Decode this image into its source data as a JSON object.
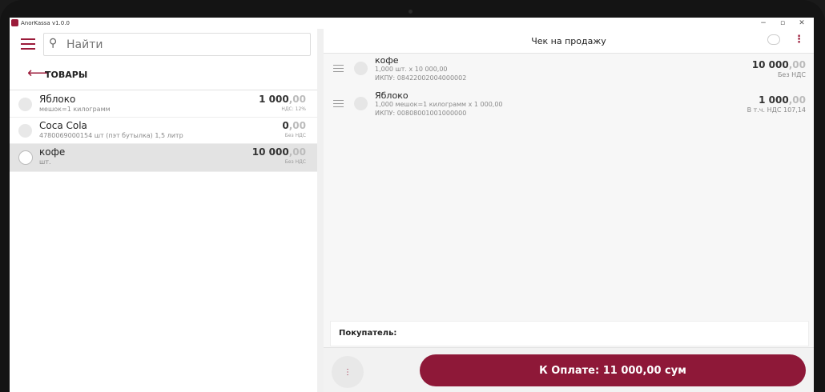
{
  "window": {
    "title": "AnorKassa v1.0.0",
    "minimize": "−",
    "restore": "▫",
    "close": "✕"
  },
  "left": {
    "search_placeholder": "Найти",
    "section": "ТОВАРЫ",
    "products": [
      {
        "name": "Яблоко",
        "sub": "мешок=1 килограмм",
        "price_int": "1 000",
        "price_dec": ",00",
        "tax": "НДС: 12%"
      },
      {
        "name": "Coca Cola",
        "sub": "4780069000154 шт (пэт бутылка) 1,5 литр",
        "price_int": "0",
        "price_dec": ",00",
        "tax": "Без НДС"
      },
      {
        "name": "кофе",
        "sub": "шт.",
        "price_int": "10 000",
        "price_dec": ",00",
        "tax": "Без НДС"
      }
    ]
  },
  "right": {
    "title": "Чек на продажу",
    "more": "⋮",
    "items": [
      {
        "name": "кофе",
        "qty": "1,000 шт. x 10 000,00",
        "code": "ИКПУ: 08422002004000002",
        "price_int": "10 000",
        "price_dec": ",00",
        "tax": "Без НДС"
      },
      {
        "name": "Яблоко",
        "qty": "1,000 мешок=1 килограмм x 1 000,00",
        "code": "ИКПУ: 00808001001000000",
        "price_int": "1 000",
        "price_dec": ",00",
        "tax": "В т.ч. НДС 107,14"
      }
    ],
    "buyer_label": "Покупатель:",
    "menu": "⋮",
    "pay_label": "К Оплате: 11 000,00 сум"
  },
  "colors": {
    "accent": "#9b1b3a",
    "pay_button": "#8e1838"
  }
}
